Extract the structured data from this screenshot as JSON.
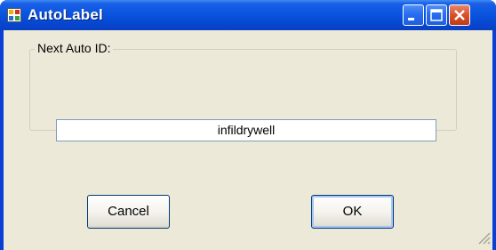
{
  "window": {
    "title": "AutoLabel",
    "app_icon": "window-app-icon",
    "controls": [
      "minimize-icon",
      "maximize-icon",
      "close-icon"
    ]
  },
  "group": {
    "label": "Next Auto ID:"
  },
  "auto_id": {
    "value": "infildrywell"
  },
  "buttons": {
    "cancel_label": "Cancel",
    "ok_label": "OK"
  },
  "colors": {
    "titlebar": "#0a55e0",
    "client_background": "#ece9d8",
    "close_button": "#d9502c"
  }
}
